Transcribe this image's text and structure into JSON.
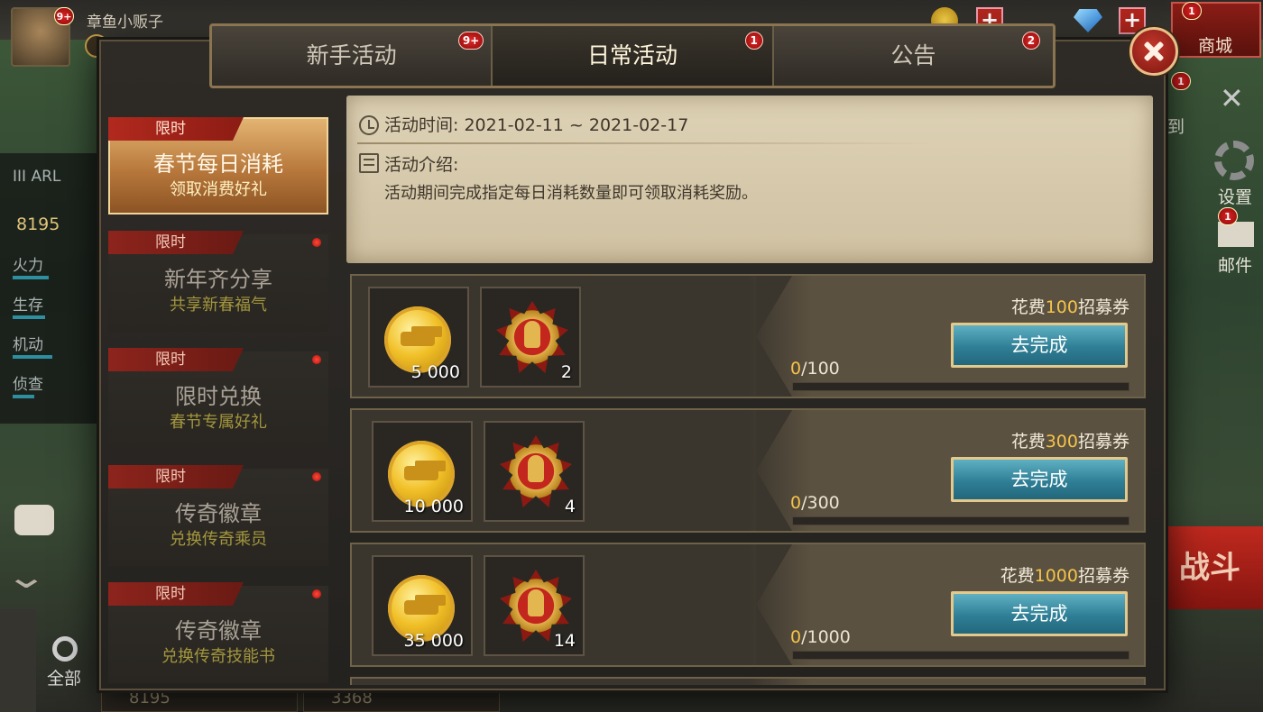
{
  "player": {
    "name": "章鱼小贩子",
    "avatar_badge": "9+",
    "power": "8195"
  },
  "topbar": {
    "shop_label": "商城",
    "shop_badge": "1"
  },
  "background_left": {
    "tag": "III ARL",
    "stats": [
      "火力",
      "生存",
      "机动",
      "侦查"
    ]
  },
  "background_right": {
    "signin": "到",
    "signin_badge": "1",
    "settings": "设置",
    "mail": "邮件",
    "mail_badge": "1",
    "battle": "战斗"
  },
  "background_bottom": {
    "filter_all": "全部",
    "cards": [
      "8195",
      "3368"
    ]
  },
  "tabs": [
    {
      "label": "新手活动",
      "badge": "9+",
      "active": false
    },
    {
      "label": "日常活动",
      "badge": "1",
      "active": true
    },
    {
      "label": "公告",
      "badge": "2",
      "active": false
    }
  ],
  "sidebar": {
    "items": [
      {
        "tag": "限时",
        "title": "春节每日消耗",
        "subtitle": "领取消费好礼",
        "active": true,
        "dot": false
      },
      {
        "tag": "限时",
        "title": "新年齐分享",
        "subtitle": "共享新春福气",
        "active": false,
        "dot": true
      },
      {
        "tag": "限时",
        "title": "限时兑换",
        "subtitle": "春节专属好礼",
        "active": false,
        "dot": true
      },
      {
        "tag": "限时",
        "title": "传奇徽章",
        "subtitle": "兑换传奇乘员",
        "active": false,
        "dot": true
      },
      {
        "tag": "限时",
        "title": "传奇徽章",
        "subtitle": "兑换传奇技能书",
        "active": false,
        "dot": true
      }
    ]
  },
  "info": {
    "time_label": "活动时间: 2021-02-11 ~ 2021-02-17",
    "intro_label": "活动介绍:",
    "intro_text": "活动期间完成指定每日消耗数量即可领取消耗奖励。"
  },
  "tasks": [
    {
      "cost_prefix": "花费",
      "cost_amount": "100",
      "cost_suffix": "招募券",
      "rewards": [
        {
          "icon": "gold-coin-icon",
          "qty": "5 000"
        },
        {
          "icon": "medal-icon",
          "qty": "2"
        }
      ],
      "progress_current": "0",
      "progress_total": "/100",
      "progress": 0,
      "button": "去完成"
    },
    {
      "cost_prefix": "花费",
      "cost_amount": "300",
      "cost_suffix": "招募券",
      "rewards": [
        {
          "icon": "gold-coin-icon",
          "qty": "10 000"
        },
        {
          "icon": "medal-icon",
          "qty": "4"
        }
      ],
      "progress_current": "0",
      "progress_total": "/300",
      "progress": 0,
      "button": "去完成"
    },
    {
      "cost_prefix": "花费",
      "cost_amount": "1000",
      "cost_suffix": "招募券",
      "rewards": [
        {
          "icon": "gold-coin-icon",
          "qty": "35 000"
        },
        {
          "icon": "medal-icon",
          "qty": "14"
        }
      ],
      "progress_current": "0",
      "progress_total": "/1000",
      "progress": 0,
      "button": "去完成"
    }
  ],
  "colors": {
    "accent_gold": "#f4c34a",
    "button_teal": "#2f7f96",
    "badge_red": "#e12828",
    "active_tab_tag": "#b1291e"
  }
}
